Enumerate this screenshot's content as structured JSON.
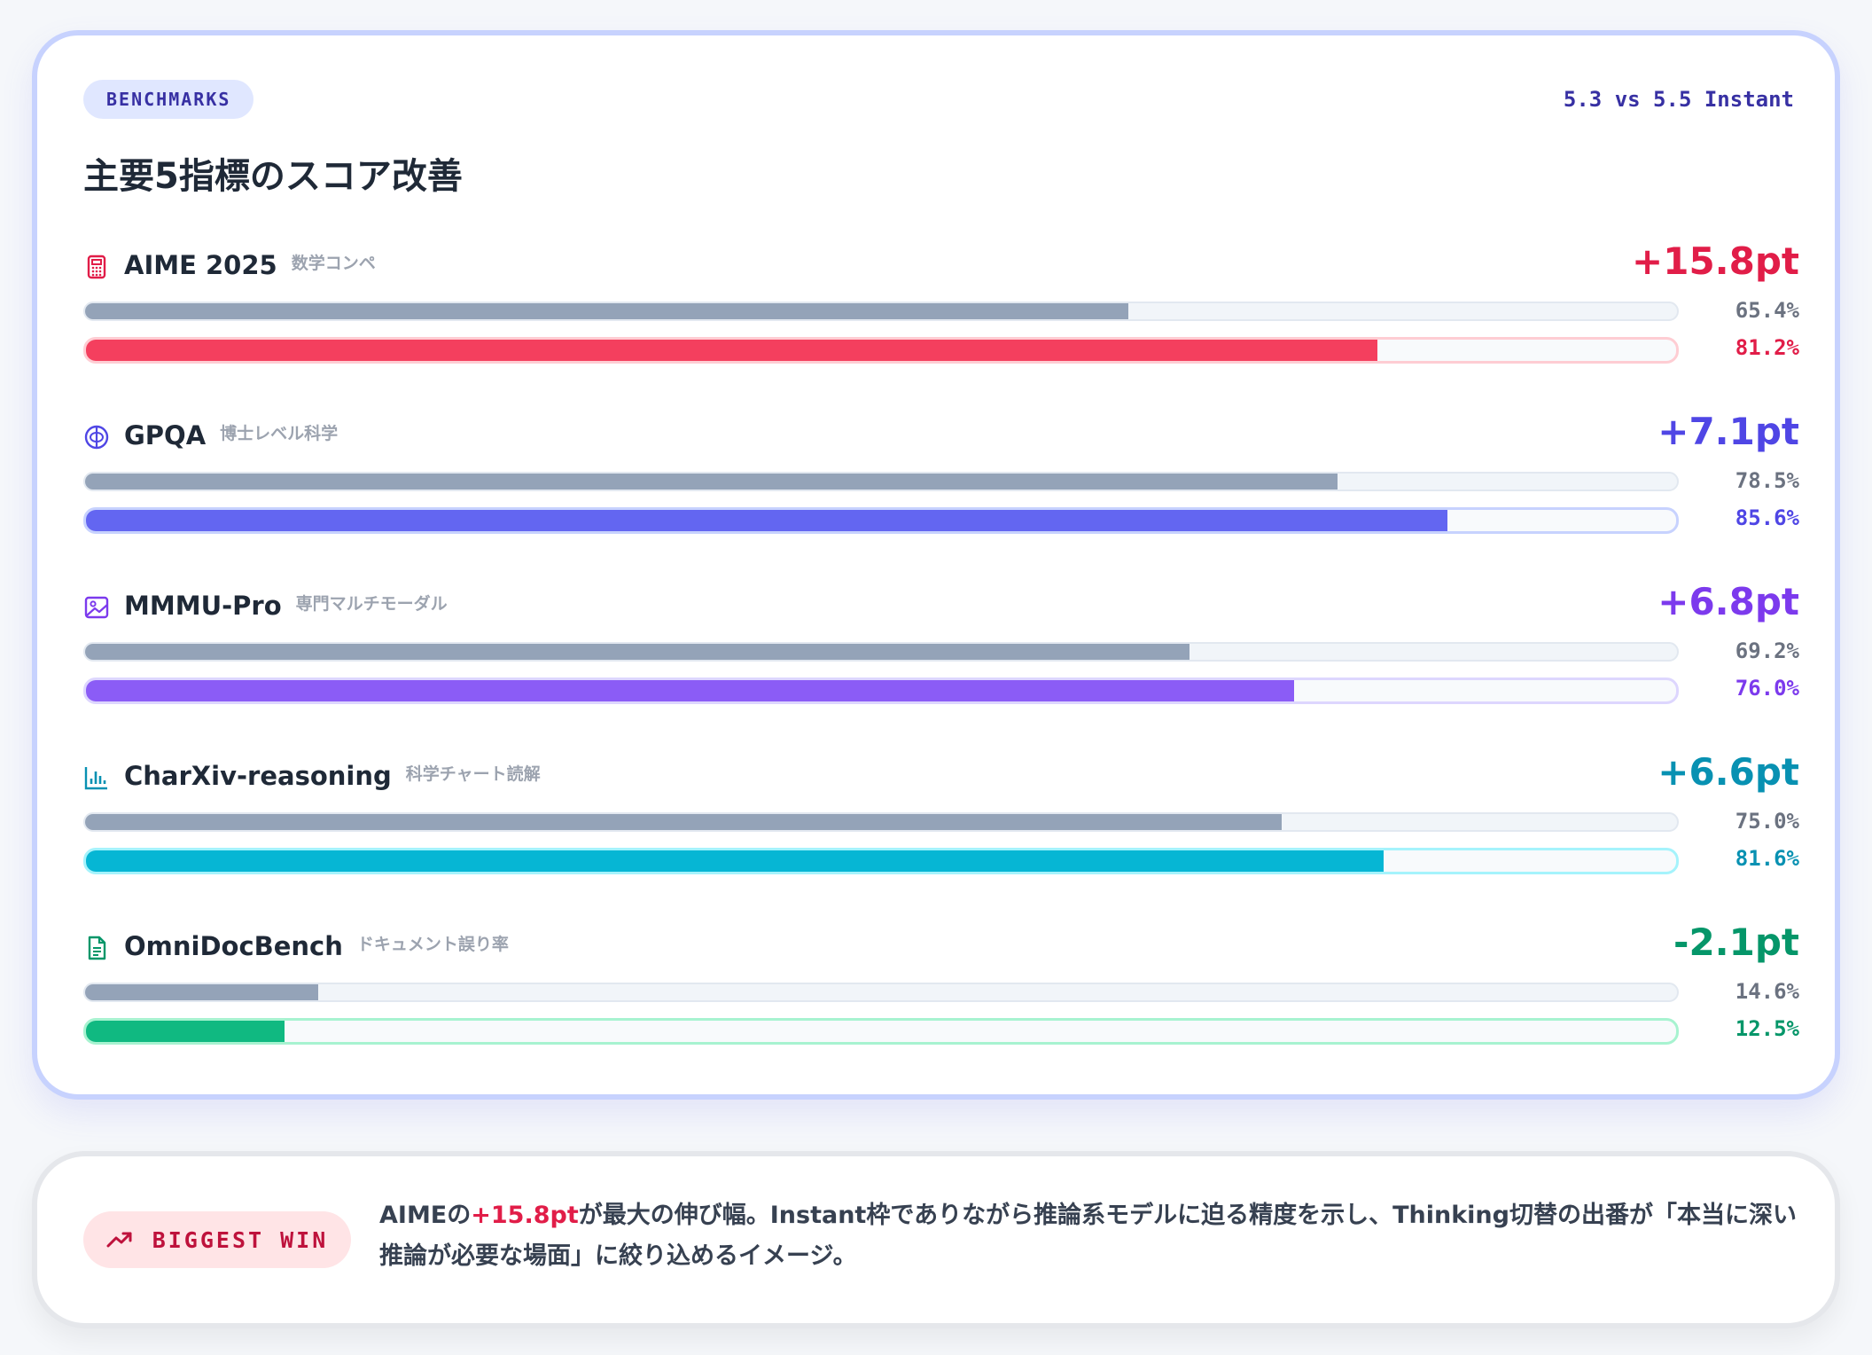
{
  "header": {
    "badge": "BENCHMARKS",
    "comparison": "5.3 vs 5.5 Instant",
    "title": "主要5指標のスコア改善"
  },
  "chart_data": {
    "type": "bar",
    "title": "主要5指標のスコア改善",
    "categories": [
      "AIME 2025",
      "GPQA",
      "MMMU-Pro",
      "CharXiv-reasoning",
      "OmniDocBench"
    ],
    "subtitles": [
      "数学コンペ",
      "博士レベル科学",
      "専門マルチモーダル",
      "科学チャート読解",
      "ドキュメント誤り率"
    ],
    "series": [
      {
        "name": "5.3",
        "values": [
          65.4,
          78.5,
          69.2,
          75.0,
          14.6
        ]
      },
      {
        "name": "5.5 Instant",
        "values": [
          81.2,
          85.6,
          76.0,
          81.6,
          12.5
        ]
      }
    ],
    "deltas": [
      "+15.8pt",
      "+7.1pt",
      "+6.8pt",
      "+6.6pt",
      "-2.1pt"
    ],
    "ylim": [
      0,
      100
    ]
  },
  "metrics": [
    {
      "name": "AIME 2025",
      "sub": "数学コンペ",
      "delta": "+15.8pt",
      "base": 65.4,
      "new": 81.2,
      "base_label": "65.4%",
      "new_label": "81.2%",
      "icon": "calculator-icon",
      "color": "#f43f5e",
      "accent": "#e11d48",
      "track_border": "#fecdd3"
    },
    {
      "name": "GPQA",
      "sub": "博士レベル科学",
      "delta": "+7.1pt",
      "base": 78.5,
      "new": 85.6,
      "base_label": "78.5%",
      "new_label": "85.6%",
      "icon": "brain-icon",
      "color": "#6366f1",
      "accent": "#4f46e5",
      "track_border": "#c7d2fe"
    },
    {
      "name": "MMMU-Pro",
      "sub": "専門マルチモーダル",
      "delta": "+6.8pt",
      "base": 69.2,
      "new": 76.0,
      "base_label": "69.2%",
      "new_label": "76.0%",
      "icon": "image-icon",
      "color": "#8b5cf6",
      "accent": "#7c3aed",
      "track_border": "#ddd6fe"
    },
    {
      "name": "CharXiv-reasoning",
      "sub": "科学チャート読解",
      "delta": "+6.6pt",
      "base": 75.0,
      "new": 81.6,
      "base_label": "75.0%",
      "new_label": "81.6%",
      "icon": "bar-chart-icon",
      "color": "#06b6d4",
      "accent": "#0891b2",
      "track_border": "#a5f3fc"
    },
    {
      "name": "OmniDocBench",
      "sub": "ドキュメント誤り率",
      "delta": "-2.1pt",
      "base": 14.6,
      "new": 12.5,
      "base_label": "14.6%",
      "new_label": "12.5%",
      "icon": "document-icon",
      "color": "#10b981",
      "accent": "#059669",
      "track_border": "#a7f3d0"
    }
  ],
  "biggest_win": {
    "badge": "BIGGEST WIN",
    "icon": "trending-up-icon",
    "text_before": "AIMEの",
    "highlight": "+15.8pt",
    "text_after": "が最大の伸び幅。Instant枠でありながら推論系モデルに迫る精度を示し、Thinking切替の出番が「本当に深い推論が必要な場面」に絞り込めるイメージ。"
  }
}
